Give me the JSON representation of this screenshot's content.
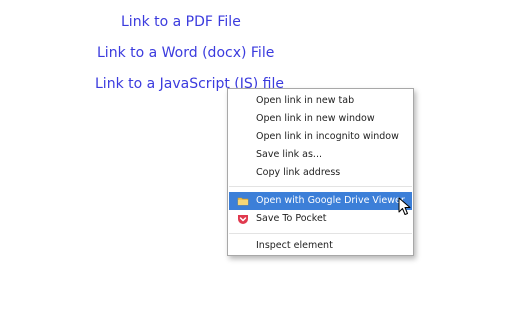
{
  "links": {
    "pdf": "Link to a PDF File",
    "docx": "Link to a Word (docx) File",
    "js": "Link to a JavaScript (JS) file"
  },
  "context_menu": {
    "open_new_tab": "Open link in new tab",
    "open_new_window": "Open link in new window",
    "open_incognito": "Open link in incognito window",
    "save_link_as": "Save link as...",
    "copy_link_address": "Copy link address",
    "open_drive_viewer": "Open with Google Drive Viewer",
    "save_to_pocket": "Save To Pocket",
    "inspect_element": "Inspect element"
  },
  "icons": {
    "drive_viewer": "folder-icon",
    "pocket": "pocket-icon",
    "cursor": "mouse-pointer-icon"
  },
  "colors": {
    "link": "#3b3bde",
    "highlight": "#3c7fd8",
    "pocket": "#e0394e",
    "folder": "#f2c14e"
  }
}
